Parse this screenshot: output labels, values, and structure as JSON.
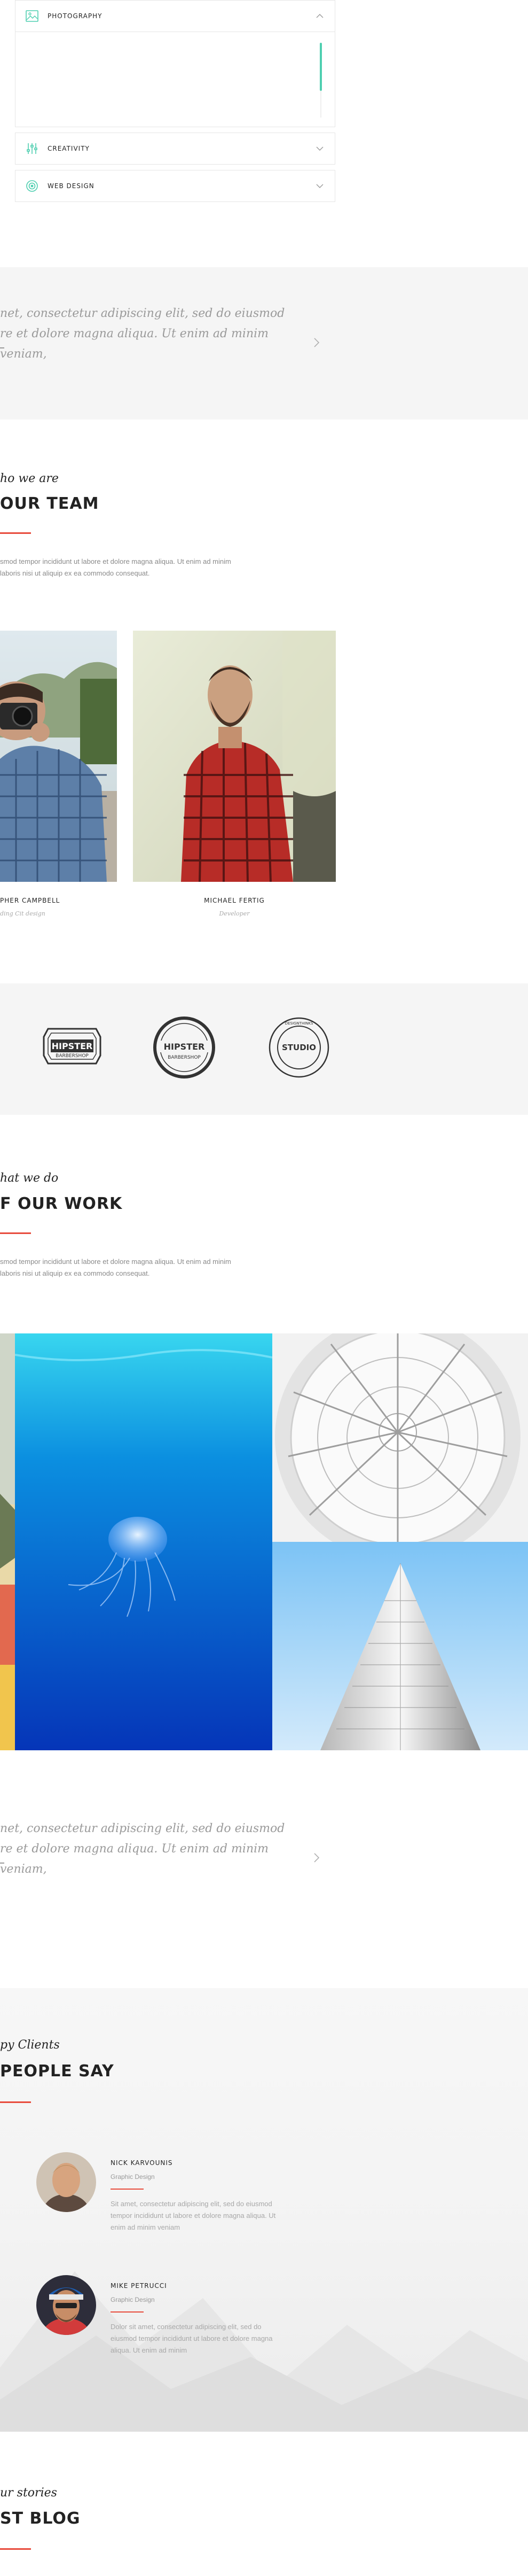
{
  "accordion": {
    "items": [
      {
        "title": "PHOTOGRAPHY",
        "icon": "image-icon",
        "expanded": true
      },
      {
        "title": "CREATIVITY",
        "icon": "sliders-icon",
        "expanded": false
      },
      {
        "title": "WEB DESIGN",
        "icon": "target-icon",
        "expanded": false
      }
    ]
  },
  "quote_1": {
    "line1": "net, consectetur adipiscing elit, sed do eiusmod",
    "line2": "re et dolore magna aliqua. Ut enim ad minim veniam,"
  },
  "team": {
    "subtitle": "ho we are",
    "title": "OUR TEAM",
    "desc_line1": "smod tempor incididunt ut labore et dolore magna aliqua. Ut enim ad minim",
    "desc_line2": " laboris nisi ut aliquip ex ea commodo consequat.",
    "members": [
      {
        "name": "PHER CAMPBELL",
        "role": "ding Cit design"
      },
      {
        "name": "MICHAEL FERTIG",
        "role": "Developer"
      }
    ]
  },
  "logos": [
    {
      "top": "HIPSTER",
      "bottom": "BARBERSHOP"
    },
    {
      "top": "HIPSTER",
      "bottom": "BARBERSHOP"
    },
    {
      "top": "STUDIO",
      "bottom": "DESIGNTHINKS"
    }
  ],
  "work": {
    "subtitle": "hat we do",
    "title": "F OUR WORK",
    "desc_line1": "smod tempor incididunt ut labore et dolore magna aliqua. Ut enim ad minim",
    "desc_line2": " laboris nisi ut aliquip ex ea commodo consequat."
  },
  "quote_2": {
    "line1": "net, consectetur adipiscing elit, sed do eiusmod",
    "line2": "re et dolore magna aliqua. Ut enim ad minim veniam,"
  },
  "clients": {
    "subtitle": "py Clients",
    "title": "PEOPLE SAY",
    "items": [
      {
        "name": "NICK KARVOUNIS",
        "role": "Graphic Design",
        "line1": "Sit amet, consectetur adipiscing elit, sed do eiusmod",
        "line2": "tempor incididunt ut labore et dolore magna aliqua. Ut",
        "line3": "enim ad minim veniam"
      },
      {
        "name": "MIKE PETRUCCI",
        "role": "Graphic Design",
        "line1": "Dolor sit amet, consectetur adipiscing elit, sed do",
        "line2": "eiusmod tempor incididunt ut labore et dolore magna",
        "line3": "aliqua. Ut enim ad minim"
      }
    ]
  },
  "blog": {
    "subtitle": "ur stories",
    "title": "ST BLOG"
  },
  "colors": {
    "accent": "#e84c3d",
    "teal": "#4fcfb0",
    "band": "#f5f5f5"
  }
}
